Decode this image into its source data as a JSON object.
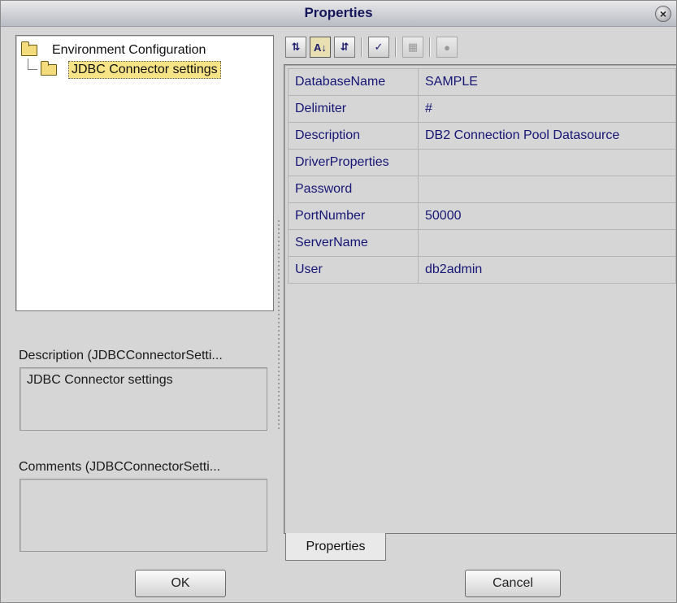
{
  "window": {
    "title": "Properties"
  },
  "tree": {
    "root_label": "Environment Configuration",
    "child_label": "JDBC Connector settings"
  },
  "description": {
    "label": "Description (JDBCConnectorSetti...",
    "value": "JDBC Connector settings"
  },
  "comments": {
    "label": "Comments (JDBCConnectorSetti...",
    "value": ""
  },
  "toolbar": {
    "buttons": [
      {
        "icon": "sort-default-icon",
        "glyph": "⇅",
        "state": "normal"
      },
      {
        "icon": "sort-alphabetical-icon",
        "glyph": "A↓",
        "state": "active"
      },
      {
        "icon": "sort-by-type-icon",
        "glyph": "⇵",
        "state": "normal"
      },
      {
        "icon": "show-editable-icon",
        "glyph": "✓",
        "state": "normal"
      },
      {
        "icon": "disabled-grid-icon",
        "glyph": "▦",
        "state": "disabled"
      },
      {
        "icon": "disabled-help-icon",
        "glyph": "●",
        "state": "disabled"
      }
    ]
  },
  "properties": {
    "rows": [
      {
        "name": "DatabaseName",
        "value": "SAMPLE"
      },
      {
        "name": "Delimiter",
        "value": "#"
      },
      {
        "name": "Description",
        "value": "DB2 Connection Pool Datasource"
      },
      {
        "name": "DriverProperties",
        "value": ""
      },
      {
        "name": "Password",
        "value": ""
      },
      {
        "name": "PortNumber",
        "value": "50000"
      },
      {
        "name": "ServerName",
        "value": ""
      },
      {
        "name": "User",
        "value": "db2admin"
      }
    ],
    "tab_label": "Properties"
  },
  "buttons": {
    "ok_label": "OK",
    "cancel_label": "Cancel"
  }
}
